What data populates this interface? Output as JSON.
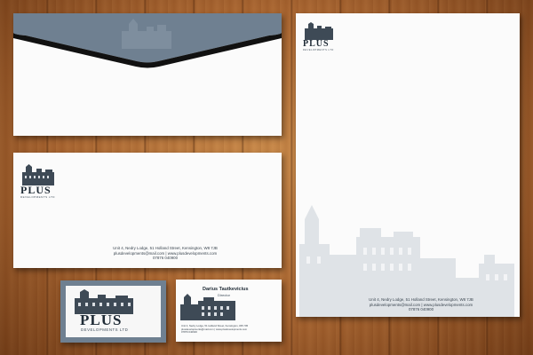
{
  "brand": {
    "name": "PLUS",
    "tagline": "DEVELOPMENTS LTD",
    "accent": "#6f8091",
    "dark": "#1f2b36",
    "building_tint": "#d9dde2"
  },
  "contact": {
    "address": "Unit 4, Nedry Lodge, 51 Holland Street, Kensington, W8 7JB",
    "email_web": "plusdevelopments@mail.com | www.plusdevelopments.com",
    "phone": "07876 040900"
  },
  "business_card": {
    "person_name": "Darius Tautkevicius",
    "person_title": "Director"
  },
  "icons": [
    "building-illustration-icon"
  ]
}
